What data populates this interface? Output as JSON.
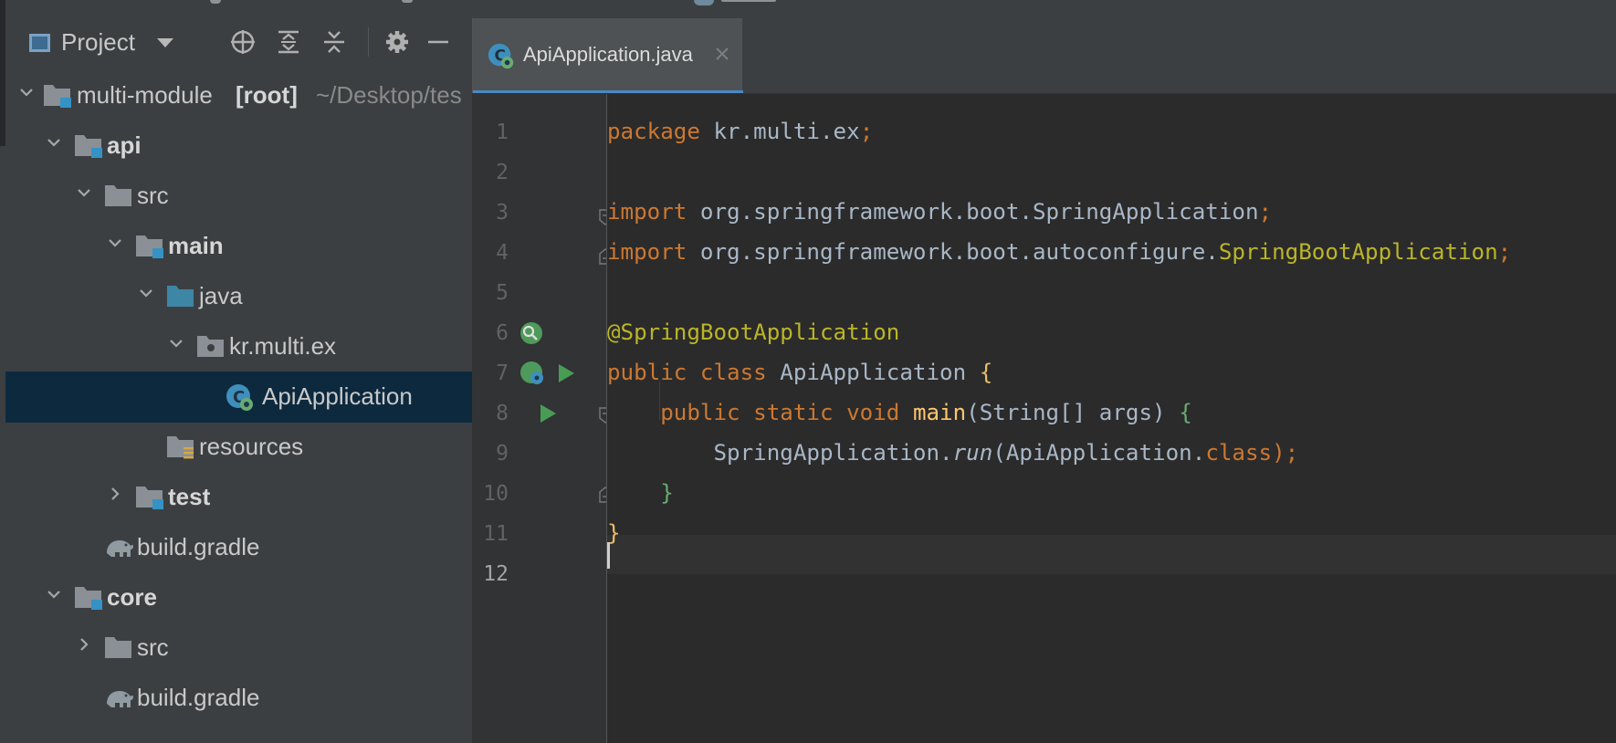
{
  "project_panel": {
    "title": "Project",
    "tree": [
      {
        "name": "multi-module",
        "suffix": "[root]",
        "path": "~/Desktop/tes"
      },
      {
        "name": "api"
      },
      {
        "name": "src"
      },
      {
        "name": "main"
      },
      {
        "name": "java"
      },
      {
        "name": "kr.multi.ex"
      },
      {
        "name": "ApiApplication"
      },
      {
        "name": "resources"
      },
      {
        "name": "test"
      },
      {
        "name": "build.gradle"
      },
      {
        "name": "core"
      },
      {
        "name": "src"
      },
      {
        "name": "build.gradle"
      }
    ]
  },
  "editor": {
    "tab": {
      "label": "ApiApplication.java"
    },
    "line_numbers": [
      "1",
      "2",
      "3",
      "4",
      "5",
      "6",
      "7",
      "8",
      "9",
      "10",
      "11",
      "12"
    ],
    "current_line": "12",
    "code": {
      "l1_kw": "package",
      "l1_rest": " kr.multi.ex",
      "semicolon": ";",
      "import_kw": "import",
      "l3_rest": " org.springframework.boot.SpringApplication",
      "l4_rest": " org.springframework.boot.autoconfigure.",
      "l4_ann": "SpringBootApplication",
      "l6_ann": "@SpringBootApplication",
      "l7_kw": "public class",
      "l7_name": " ApiApplication ",
      "open_brace": "{",
      "l8_indent": "    ",
      "l8_kw": "public static void",
      "l8_fn": "main",
      "l8_args": "(String[] args) ",
      "l9_indent": "        ",
      "l9_a": "SpringApplication.",
      "l9_run": "run",
      "l9_b": "(ApiApplication.",
      "l9_cls": "class",
      "l9_c": ");",
      "l10_indent": "    ",
      "close_brace": "}"
    }
  },
  "colors": {
    "accent": "#4a88c7",
    "keyword": "#cc7832",
    "annotation": "#bbb529",
    "function": "#ffc66d",
    "selection": "#0d293e",
    "run_green": "#499c54"
  }
}
